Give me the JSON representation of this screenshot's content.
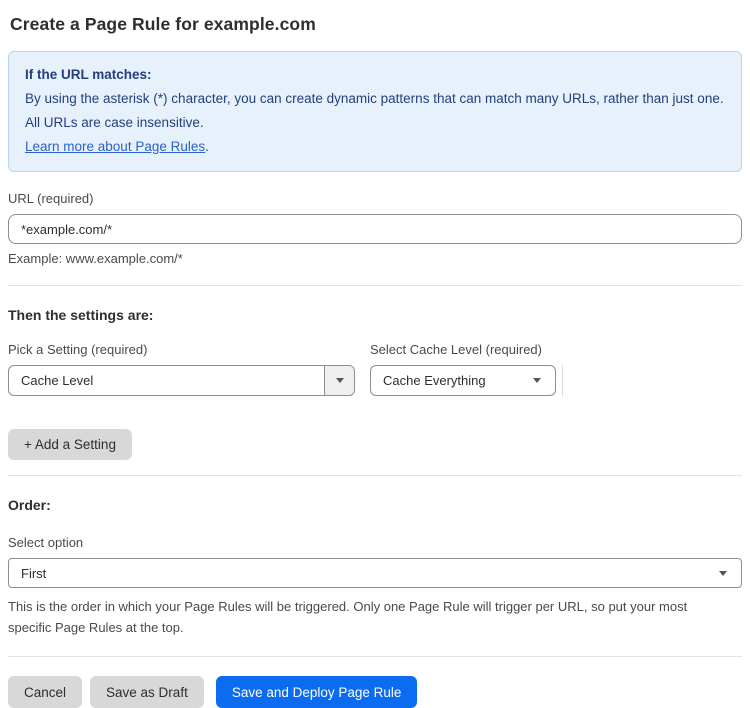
{
  "page": {
    "title": "Create a Page Rule for example.com"
  },
  "info_box": {
    "heading": "If the URL matches:",
    "body": "By using the asterisk (*) character, you can create dynamic patterns that can match many URLs, rather than just one. All URLs are case insensitive.",
    "link_label": "Learn more about Page Rules",
    "link_suffix": "."
  },
  "url_section": {
    "label": "URL (required)",
    "value": "*example.com/*",
    "helper": "Example: www.example.com/*"
  },
  "settings_section": {
    "heading": "Then the settings are:",
    "setting_label": "Pick a Setting (required)",
    "setting_value": "Cache Level",
    "cache_label": "Select Cache Level (required)",
    "cache_value": "Cache Everything",
    "add_button_label": "+ Add a Setting"
  },
  "order_section": {
    "heading": "Order:",
    "label": "Select option",
    "value": "First",
    "helper": "This is the order in which your Page Rules will be triggered. Only one Page Rule will trigger per URL, so put your most specific Page Rules at the top."
  },
  "footer": {
    "cancel_label": "Cancel",
    "save_draft_label": "Save as Draft",
    "save_deploy_label": "Save and Deploy Page Rule"
  },
  "colors": {
    "accent_blue": "#0b6cf2",
    "info_background": "#e6f1fc",
    "info_border": "#b9d5f1",
    "info_text": "#24407d",
    "link_blue": "#2b62c9"
  }
}
